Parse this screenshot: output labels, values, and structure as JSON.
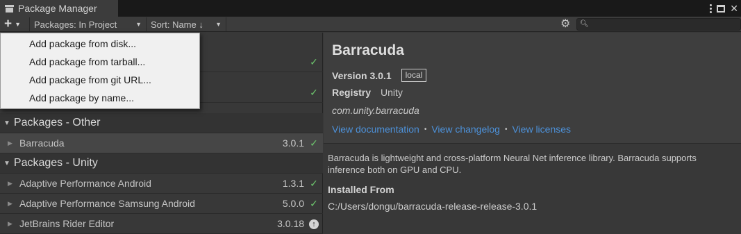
{
  "window": {
    "title": "Package Manager"
  },
  "toolbar": {
    "add_icon": "plus-icon",
    "filter_label": "Packages: In Project",
    "sort_label": "Sort: Name ↓",
    "search_placeholder": ""
  },
  "add_menu": {
    "items": [
      {
        "label": "Add package from disk..."
      },
      {
        "label": "Add package from tarball..."
      },
      {
        "label": "Add package from git URL..."
      },
      {
        "label": "Add package by name..."
      }
    ]
  },
  "list": {
    "hidden_rows": [
      {
        "status": "check"
      },
      {
        "status": "check"
      }
    ],
    "groups": [
      {
        "title": "Packages - Other",
        "packages": [
          {
            "name": "Barracuda",
            "version": "3.0.1",
            "status": "check",
            "selected": true
          }
        ]
      },
      {
        "title": "Packages - Unity",
        "packages": [
          {
            "name": "Adaptive Performance Android",
            "version": "1.3.1",
            "status": "check"
          },
          {
            "name": "Adaptive Performance Samsung Android",
            "version": "5.0.0",
            "status": "check"
          },
          {
            "name": "JetBrains Rider Editor",
            "version": "3.0.18",
            "status": "update"
          }
        ]
      }
    ]
  },
  "detail": {
    "title": "Barracuda",
    "version_label": "Version 3.0.1",
    "version_tag": "local",
    "registry_label": "Registry",
    "registry_value": "Unity",
    "package_id": "com.unity.barracuda",
    "links": {
      "documentation": "View documentation",
      "changelog": "View changelog",
      "licenses": "View licenses"
    },
    "description": "Barracuda is lightweight and cross-platform Neural Net inference library. Barracuda supports inference both on GPU and CPU.",
    "installed_from_label": "Installed From",
    "installed_from_path": "C:/Users/dongu/barracuda-release-release-3.0.1"
  },
  "colors": {
    "link": "#4d91d9",
    "check": "#6cc36c",
    "menu_bg": "#f0f0f0"
  }
}
